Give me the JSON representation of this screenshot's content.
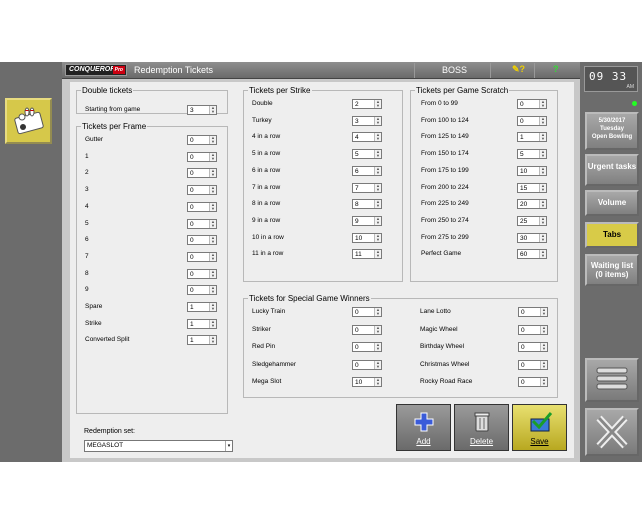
{
  "window": {
    "logo": "CONQUEROR",
    "logo_badge": "Pro",
    "title": "Redemption Tickets",
    "user": "BOSS",
    "help_icon": "help-question-icon",
    "check_icon": "check-question-icon"
  },
  "double_tickets": {
    "legend": "Double tickets",
    "label": "Starting from game",
    "value": "3"
  },
  "per_frame": {
    "legend": "Tickets per Frame",
    "rows": [
      {
        "label": "Gutter",
        "value": "0"
      },
      {
        "label": "1",
        "value": "0"
      },
      {
        "label": "2",
        "value": "0"
      },
      {
        "label": "3",
        "value": "0"
      },
      {
        "label": "4",
        "value": "0"
      },
      {
        "label": "5",
        "value": "0"
      },
      {
        "label": "6",
        "value": "0"
      },
      {
        "label": "7",
        "value": "0"
      },
      {
        "label": "8",
        "value": "0"
      },
      {
        "label": "9",
        "value": "0"
      },
      {
        "label": "Spare",
        "value": "1"
      },
      {
        "label": "Strike",
        "value": "1"
      },
      {
        "label": "Converted Split",
        "value": "1"
      }
    ]
  },
  "per_strike": {
    "legend": "Tickets per Strike",
    "rows": [
      {
        "label": "Double",
        "value": "2"
      },
      {
        "label": "Turkey",
        "value": "3"
      },
      {
        "label": "4 in a row",
        "value": "4"
      },
      {
        "label": "5 in a row",
        "value": "5"
      },
      {
        "label": "6 in a row",
        "value": "6"
      },
      {
        "label": "7 in a row",
        "value": "7"
      },
      {
        "label": "8 in a row",
        "value": "8"
      },
      {
        "label": "9 in a row",
        "value": "9"
      },
      {
        "label": "10 in a row",
        "value": "10"
      },
      {
        "label": "11 in a row",
        "value": "11"
      }
    ]
  },
  "per_scratch": {
    "legend": "Tickets per Game Scratch",
    "rows": [
      {
        "label": "From 0 to 99",
        "value": "0"
      },
      {
        "label": "From 100 to 124",
        "value": "0"
      },
      {
        "label": "From 125 to 149",
        "value": "1"
      },
      {
        "label": "From 150 to 174",
        "value": "5"
      },
      {
        "label": "From 175 to 199",
        "value": "10"
      },
      {
        "label": "From 200 to 224",
        "value": "15"
      },
      {
        "label": "From 225 to 249",
        "value": "20"
      },
      {
        "label": "From 250 to 274",
        "value": "25"
      },
      {
        "label": "From 275 to 299",
        "value": "30"
      },
      {
        "label": "Perfect Game",
        "value": "60"
      }
    ]
  },
  "special": {
    "legend": "Tickets for Special Game Winners",
    "left": [
      {
        "label": "Lucky Train",
        "value": "0"
      },
      {
        "label": "Striker",
        "value": "0"
      },
      {
        "label": "Red Pin",
        "value": "0"
      },
      {
        "label": "Sledgehammer",
        "value": "0"
      },
      {
        "label": "Mega Slot",
        "value": "10"
      }
    ],
    "right": [
      {
        "label": "Lane Lotto",
        "value": "0"
      },
      {
        "label": "Magic Wheel",
        "value": "0"
      },
      {
        "label": "Birthday Wheel",
        "value": "0"
      },
      {
        "label": "Christmas Wheel",
        "value": "0"
      },
      {
        "label": "Rocky Road Race",
        "value": "0"
      }
    ]
  },
  "redemption_set": {
    "label": "Redemption set:",
    "value": "MEGASLOT"
  },
  "actions": {
    "add": "Add",
    "delete": "Delete",
    "save": "Save"
  },
  "sidebar": {
    "time": "09 33",
    "ampm": "AM",
    "date": "5/30/2017",
    "day": "Tuesday",
    "mode": "Open Bowling",
    "urgent": "Urgent tasks",
    "volume": "Volume",
    "tabs": "Tabs",
    "waiting": "Waiting list",
    "waiting_count": "(0 items)"
  },
  "colors": {
    "accent": "#d8cb48",
    "panel": "#eeeeee",
    "chrome": "#6c6c6c"
  }
}
